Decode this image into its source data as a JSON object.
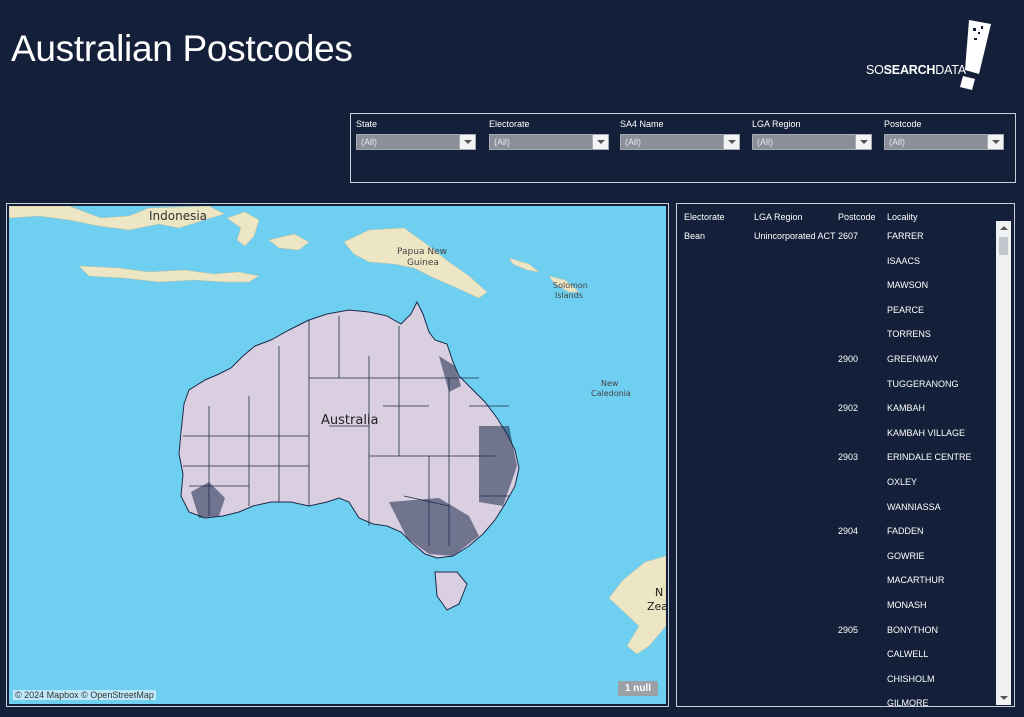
{
  "header": {
    "title": "Australian Postcodes"
  },
  "logo": {
    "prefix": "SO",
    "bold": "SEARCH",
    "suffix": "DATA"
  },
  "filters": [
    {
      "label": "State",
      "value": "(All)"
    },
    {
      "label": "Electorate",
      "value": "(All)"
    },
    {
      "label": "SA4 Name",
      "value": "(All)"
    },
    {
      "label": "LGA Region",
      "value": "(All)"
    },
    {
      "label": "Postcode",
      "value": "(All)"
    }
  ],
  "map": {
    "labels": {
      "indonesia": "Indonesia",
      "papua1": "Papua New",
      "papua2": "Guinea",
      "solomon1": "Solomon",
      "solomon2": "Islands",
      "caledonia1": "New",
      "caledonia2": "Caledonia",
      "australia": "Australia",
      "nz1": "N",
      "nz2": "Zea"
    },
    "attribution": "© 2024 Mapbox © OpenStreetMap",
    "null_badge": "1 null",
    "colors": {
      "ocean": "#6fcff0",
      "land": "#ece6c4",
      "australia": "#d9cfe0",
      "borders": "#1b2a4a"
    }
  },
  "table": {
    "columns": [
      "Electorate",
      "LGA Region",
      "Postcode",
      "Locality"
    ],
    "electorate": "Bean",
    "lga_region": "Unincorporated ACT",
    "postcodes": [
      {
        "postcode": "2607",
        "row": 0
      },
      {
        "postcode": "2900",
        "row": 5
      },
      {
        "postcode": "2902",
        "row": 7
      },
      {
        "postcode": "2903",
        "row": 9
      },
      {
        "postcode": "2904",
        "row": 12
      },
      {
        "postcode": "2905",
        "row": 16
      }
    ],
    "localities": [
      "FARRER",
      "ISAACS",
      "MAWSON",
      "PEARCE",
      "TORRENS",
      "GREENWAY",
      "TUGGERANONG",
      "KAMBAH",
      "KAMBAH VILLAGE",
      "ERINDALE CENTRE",
      "OXLEY",
      "WANNIASSA",
      "FADDEN",
      "GOWRIE",
      "MACARTHUR",
      "MONASH",
      "BONYTHON",
      "CALWELL",
      "CHISHOLM",
      "GILMORE"
    ]
  },
  "theme": {
    "background": "#142039",
    "accent": "#ffffff"
  }
}
